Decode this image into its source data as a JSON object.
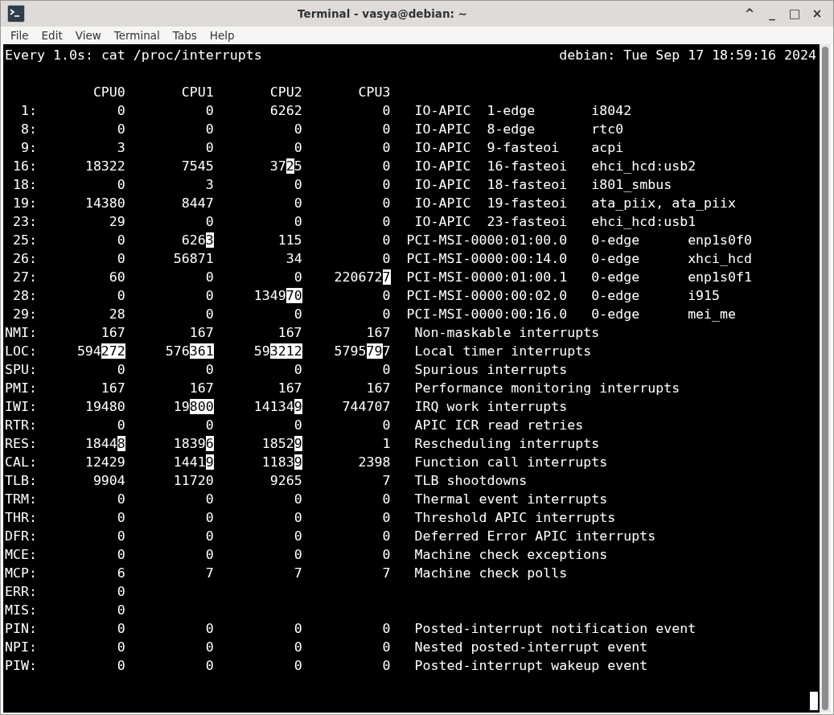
{
  "window": {
    "title": "Terminal - vasya@debian: ~",
    "controls": [
      "^",
      "_",
      "□",
      "×"
    ]
  },
  "menu": [
    "File",
    "Edit",
    "View",
    "Terminal",
    "Tabs",
    "Help"
  ],
  "terminal": {
    "command_line": "Every 1.0s: cat /proc/interrupts",
    "host_time": "debian: Tue Sep 17 18:59:16 2024",
    "cpu_headings": [
      "CPU0",
      "CPU1",
      "CPU2",
      "CPU3"
    ],
    "rows": [
      {
        "label": "1:",
        "kind": "io-apic",
        "counts": [
          "0",
          "0",
          "6262",
          "0"
        ],
        "chip": "IO-APIC",
        "irq_type": "1-edge",
        "device": "i8042"
      },
      {
        "label": "8:",
        "kind": "io-apic",
        "counts": [
          "0",
          "0",
          "0",
          "0"
        ],
        "chip": "IO-APIC",
        "irq_type": "8-edge",
        "device": "rtc0"
      },
      {
        "label": "9:",
        "kind": "io-apic",
        "counts": [
          "3",
          "0",
          "0",
          "0"
        ],
        "chip": "IO-APIC",
        "irq_type": "9-fasteoi",
        "device": "acpi"
      },
      {
        "label": "16:",
        "kind": "io-apic",
        "counts": [
          "18322",
          "7545",
          [
            {
              "text": "37",
              "changed": false
            },
            {
              "text": "2",
              "changed": true
            },
            {
              "text": "5",
              "changed": false
            }
          ],
          "0"
        ],
        "chip": "IO-APIC",
        "irq_type": "16-fasteoi",
        "device": "ehci_hcd:usb2"
      },
      {
        "label": "18:",
        "kind": "io-apic",
        "counts": [
          "0",
          "3",
          "0",
          "0"
        ],
        "chip": "IO-APIC",
        "irq_type": "18-fasteoi",
        "device": "i801_smbus"
      },
      {
        "label": "19:",
        "kind": "io-apic",
        "counts": [
          "14380",
          "8447",
          "0",
          "0"
        ],
        "chip": "IO-APIC",
        "irq_type": "19-fasteoi",
        "device": "ata_piix, ata_piix"
      },
      {
        "label": "23:",
        "kind": "io-apic",
        "counts": [
          "29",
          "0",
          "0",
          "0"
        ],
        "chip": "IO-APIC",
        "irq_type": "23-fasteoi",
        "device": "ehci_hcd:usb1"
      },
      {
        "label": "25:",
        "kind": "msi",
        "counts": [
          "0",
          [
            {
              "text": "626",
              "changed": false
            },
            {
              "text": "3",
              "changed": true
            }
          ],
          "115",
          "0"
        ],
        "chip": "PCI-MSI-0000:01:00.0",
        "irq_type": "0-edge",
        "device": "enp1s0f0"
      },
      {
        "label": "26:",
        "kind": "msi",
        "counts": [
          "0",
          "56871",
          "34",
          "0"
        ],
        "chip": "PCI-MSI-0000:00:14.0",
        "irq_type": "0-edge",
        "device": "xhci_hcd"
      },
      {
        "label": "27:",
        "kind": "msi",
        "counts": [
          "60",
          "0",
          "0",
          [
            {
              "text": "220672",
              "changed": false
            },
            {
              "text": "7",
              "changed": true
            }
          ]
        ],
        "chip": "PCI-MSI-0000:01:00.1",
        "irq_type": "0-edge",
        "device": "enp1s0f1"
      },
      {
        "label": "28:",
        "kind": "msi",
        "counts": [
          "0",
          "0",
          [
            {
              "text": "1349",
              "changed": false
            },
            {
              "text": "70",
              "changed": true
            }
          ],
          "0"
        ],
        "chip": "PCI-MSI-0000:00:02.0",
        "irq_type": "0-edge",
        "device": "i915"
      },
      {
        "label": "29:",
        "kind": "msi",
        "counts": [
          "28",
          "0",
          "0",
          "0"
        ],
        "chip": "PCI-MSI-0000:00:16.0",
        "irq_type": "0-edge",
        "device": "mei_me"
      },
      {
        "label": "NMI:",
        "kind": "named",
        "counts": [
          "167",
          "167",
          "167",
          "167"
        ],
        "description": "Non-maskable interrupts"
      },
      {
        "label": "LOC:",
        "kind": "named",
        "counts": [
          [
            {
              "text": "594",
              "changed": false
            },
            {
              "text": "272",
              "changed": true
            }
          ],
          [
            {
              "text": "576",
              "changed": false
            },
            {
              "text": "361",
              "changed": true
            }
          ],
          [
            {
              "text": "59",
              "changed": false
            },
            {
              "text": "3212",
              "changed": true
            }
          ],
          [
            {
              "text": "5795",
              "changed": false
            },
            {
              "text": "79",
              "changed": true
            },
            {
              "text": "7",
              "changed": false
            }
          ]
        ],
        "description": "Local timer interrupts"
      },
      {
        "label": "SPU:",
        "kind": "named",
        "counts": [
          "0",
          "0",
          "0",
          "0"
        ],
        "description": "Spurious interrupts"
      },
      {
        "label": "PMI:",
        "kind": "named",
        "counts": [
          "167",
          "167",
          "167",
          "167"
        ],
        "description": "Performance monitoring interrupts"
      },
      {
        "label": "IWI:",
        "kind": "named",
        "counts": [
          "19480",
          [
            {
              "text": "19",
              "changed": false
            },
            {
              "text": "800",
              "changed": true
            }
          ],
          [
            {
              "text": "14134",
              "changed": false
            },
            {
              "text": "9",
              "changed": true
            }
          ],
          "744707"
        ],
        "description": "IRQ work interrupts"
      },
      {
        "label": "RTR:",
        "kind": "named",
        "counts": [
          "0",
          "0",
          "0",
          "0"
        ],
        "description": "APIC ICR read retries"
      },
      {
        "label": "RES:",
        "kind": "named",
        "counts": [
          [
            {
              "text": "1844",
              "changed": false
            },
            {
              "text": "8",
              "changed": true
            }
          ],
          [
            {
              "text": "1839",
              "changed": false
            },
            {
              "text": "6",
              "changed": true
            }
          ],
          [
            {
              "text": "1852",
              "changed": false
            },
            {
              "text": "9",
              "changed": true
            }
          ],
          "1"
        ],
        "description": "Rescheduling interrupts"
      },
      {
        "label": "CAL:",
        "kind": "named",
        "counts": [
          "12429",
          [
            {
              "text": "1441",
              "changed": false
            },
            {
              "text": "9",
              "changed": true
            }
          ],
          [
            {
              "text": "1183",
              "changed": false
            },
            {
              "text": "9",
              "changed": true
            }
          ],
          "2398"
        ],
        "description": "Function call interrupts"
      },
      {
        "label": "TLB:",
        "kind": "named",
        "counts": [
          "9904",
          "11720",
          "9265",
          "7"
        ],
        "description": "TLB shootdowns"
      },
      {
        "label": "TRM:",
        "kind": "named",
        "counts": [
          "0",
          "0",
          "0",
          "0"
        ],
        "description": "Thermal event interrupts"
      },
      {
        "label": "THR:",
        "kind": "named",
        "counts": [
          "0",
          "0",
          "0",
          "0"
        ],
        "description": "Threshold APIC interrupts"
      },
      {
        "label": "DFR:",
        "kind": "named",
        "counts": [
          "0",
          "0",
          "0",
          "0"
        ],
        "description": "Deferred Error APIC interrupts"
      },
      {
        "label": "MCE:",
        "kind": "named",
        "counts": [
          "0",
          "0",
          "0",
          "0"
        ],
        "description": "Machine check exceptions"
      },
      {
        "label": "MCP:",
        "kind": "named",
        "counts": [
          "6",
          "7",
          "7",
          "7"
        ],
        "description": "Machine check polls"
      },
      {
        "label": "ERR:",
        "kind": "named",
        "counts": [
          "0"
        ]
      },
      {
        "label": "MIS:",
        "kind": "named",
        "counts": [
          "0"
        ]
      },
      {
        "label": "PIN:",
        "kind": "named",
        "counts": [
          "0",
          "0",
          "0",
          "0"
        ],
        "description": "Posted-interrupt notification event"
      },
      {
        "label": "NPI:",
        "kind": "named",
        "counts": [
          "0",
          "0",
          "0",
          "0"
        ],
        "description": "Nested posted-interrupt event"
      },
      {
        "label": "PIW:",
        "kind": "named",
        "counts": [
          "0",
          "0",
          "0",
          "0"
        ],
        "description": "Posted-interrupt wakeup event"
      }
    ]
  }
}
